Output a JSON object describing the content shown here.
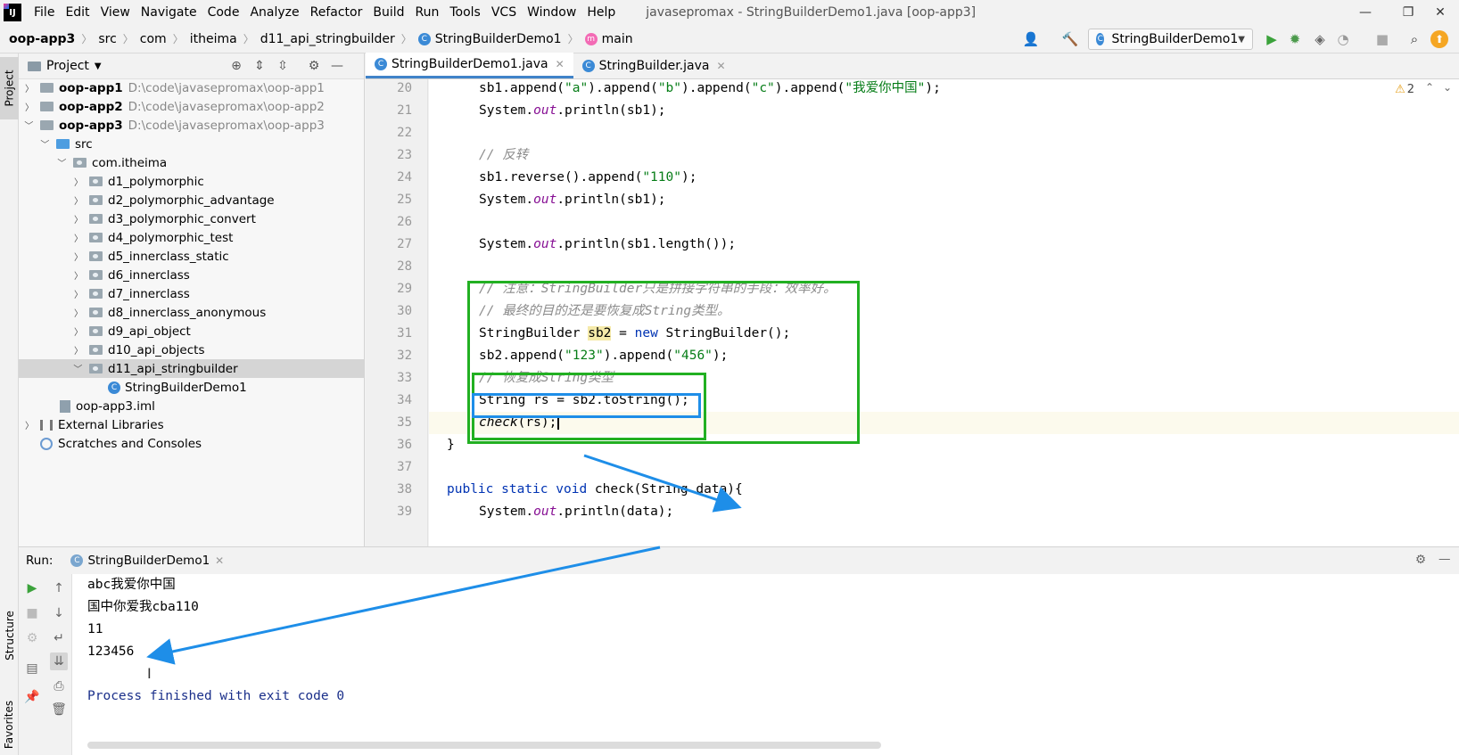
{
  "menubar": {
    "items": [
      "File",
      "Edit",
      "View",
      "Navigate",
      "Code",
      "Analyze",
      "Refactor",
      "Build",
      "Run",
      "Tools",
      "VCS",
      "Window",
      "Help"
    ],
    "window_title": "javasepromax - StringBuilderDemo1.java [oop-app3]"
  },
  "breadcrumb": {
    "items": [
      "oop-app3",
      "src",
      "com",
      "itheima",
      "d11_api_stringbuilder",
      "StringBuilderDemo1",
      "main"
    ]
  },
  "toolbar": {
    "run_config": "StringBuilderDemo1"
  },
  "left_stripe": {
    "project_tab": "Project",
    "structure_tab": "Structure",
    "favorites_tab": "Favorites"
  },
  "project_panel": {
    "title": "Project",
    "tree": [
      {
        "label": "oop-app1",
        "path": "D:\\code\\javasepromax\\oop-app1"
      },
      {
        "label": "oop-app2",
        "path": "D:\\code\\javasepromax\\oop-app2"
      },
      {
        "label": "oop-app3",
        "path": "D:\\code\\javasepromax\\oop-app3"
      },
      {
        "label": "src"
      },
      {
        "label": "com.itheima"
      },
      {
        "label": "d1_polymorphic"
      },
      {
        "label": "d2_polymorphic_advantage"
      },
      {
        "label": "d3_polymorphic_convert"
      },
      {
        "label": "d4_polymorphic_test"
      },
      {
        "label": "d5_innerclass_static"
      },
      {
        "label": "d6_innerclass"
      },
      {
        "label": "d7_innerclass"
      },
      {
        "label": "d8_innerclass_anonymous"
      },
      {
        "label": "d9_api_object"
      },
      {
        "label": "d10_api_objects"
      },
      {
        "label": "d11_api_stringbuilder"
      },
      {
        "label": "StringBuilderDemo1"
      },
      {
        "label": "oop-app3.iml"
      },
      {
        "label": "External Libraries"
      },
      {
        "label": "Scratches and Consoles"
      }
    ]
  },
  "editor": {
    "tabs": [
      "StringBuilderDemo1.java",
      "StringBuilder.java"
    ],
    "warning_count": "2",
    "line_numbers": [
      "20",
      "21",
      "22",
      "23",
      "24",
      "25",
      "26",
      "27",
      "28",
      "29",
      "30",
      "31",
      "32",
      "33",
      "34",
      "35",
      "36",
      "37",
      "38",
      "39"
    ],
    "code": {
      "l20_a": "sb1.append(",
      "l20_s1": "\"a\"",
      "l20_b": ").append(",
      "l20_s2": "\"b\"",
      "l20_c": ").append(",
      "l20_s3": "\"c\"",
      "l20_d": ").append(",
      "l20_s4": "\"我爱你中国\"",
      "l20_e": ");",
      "sys": "System.",
      "out": "out",
      "println_sb1": ".println(sb1);",
      "l23_cmt": "// 反转",
      "l24_a": "sb1.reverse().append(",
      "l24_s": "\"110\"",
      "l24_b": ");",
      "println_len": ".println(sb1.length());",
      "l29_cmt": "// 注意：StringBuilder只是拼接字符串的手段：效率好。",
      "l30_cmt": "// 最终的目的还是要恢复成String类型。",
      "l31_a": "StringBuilder ",
      "l31_var": "sb2",
      "l31_b": " = ",
      "l31_new": "new",
      "l31_c": " StringBuilder();",
      "l32_a": "sb2.append(",
      "l32_s1": "\"123\"",
      "l32_b": ").append(",
      "l32_s2": "\"456\"",
      "l32_c": ");",
      "l33_cmt": "// 恢复成String类型",
      "l34": "String rs = sb2.toString();",
      "l35_call": "check",
      "l35_rest": "(rs);",
      "l36": "}",
      "l38_a": "public",
      "l38_b": "static",
      "l38_c": "void",
      "l38_d": " check(String data){",
      "println_data": ".println(data);"
    }
  },
  "run_panel": {
    "label": "Run:",
    "tab": "StringBuilderDemo1",
    "output": [
      "abc我爱你中国",
      "国中你爱我cba110",
      "11",
      "123456",
      "Process finished with exit code 0"
    ]
  },
  "colors": {
    "annotation_green": "#22b022",
    "annotation_blue": "#1e8ee8",
    "keyword": "#0033b3",
    "string": "#067d17",
    "comment": "#8c8c8c"
  }
}
